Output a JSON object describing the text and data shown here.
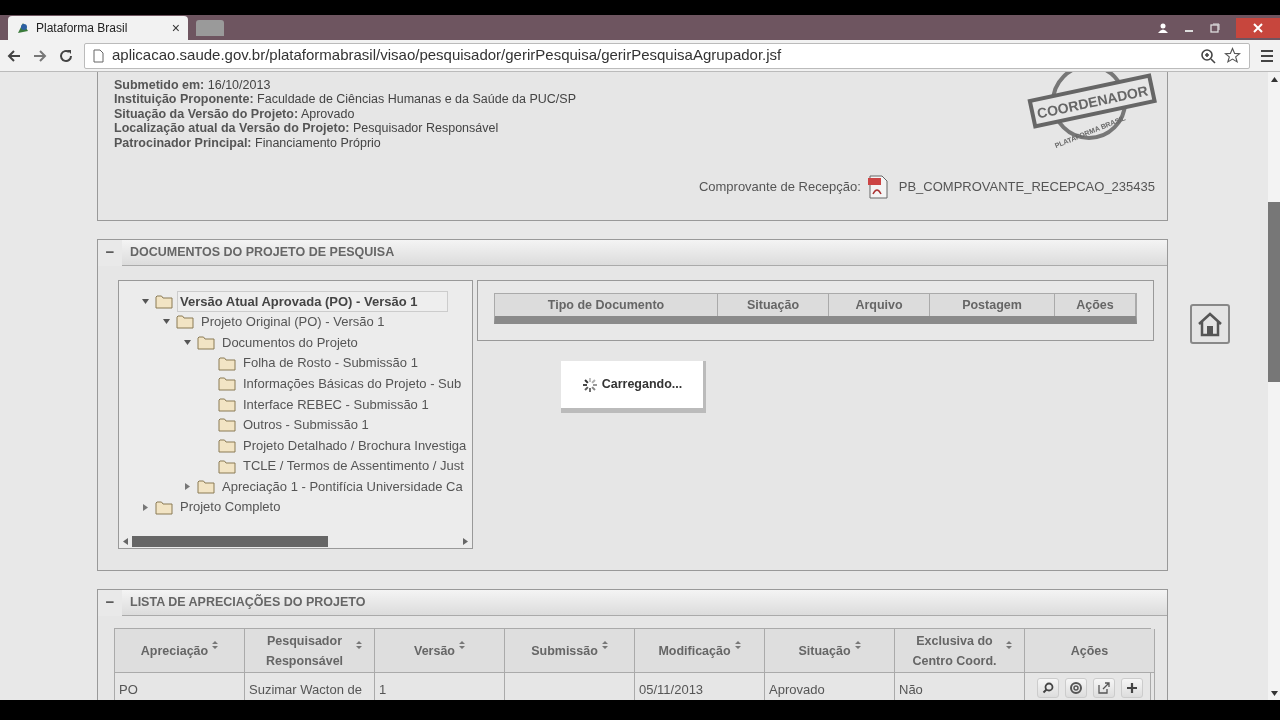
{
  "browser": {
    "tabs": [
      {
        "title": "Plataforma Brasil",
        "close": "×",
        "selected": true
      },
      {
        "selected": false
      }
    ],
    "url": "aplicacao.saude.gov.br/plataformabrasil/visao/pesquisador/gerirPesquisa/gerirPesquisaAgrupador.jsf"
  },
  "info": {
    "fields": [
      {
        "label": "Submetido em:",
        "value": "16/10/2013"
      },
      {
        "label": "Instituição Proponente:",
        "value": "Faculdade de Ciências Humanas e da Saúde da PUC/SP"
      },
      {
        "label": "Situação da Versão do Projeto:",
        "value": "Aprovado"
      },
      {
        "label": "Localização atual da Versão do Projeto:",
        "value": "Pesquisador Responsável"
      },
      {
        "label": "Patrocinador Principal:",
        "value": "Financiamento Próprio"
      }
    ],
    "stamp": {
      "label": "COORDENADOR",
      "ring_text": "PLATAFORMA BRASIL"
    },
    "receipt_label": "Comprovante de Recepção:",
    "receipt_file": "PB_COMPROVANTE_RECEPCAO_235435"
  },
  "documents": {
    "toggle": "−",
    "title": "DOCUMENTOS DO PROJETO DE PESQUISA",
    "tree": [
      {
        "label": "Versão Atual Aprovada (PO) - Versão 1",
        "selected": true,
        "expanded": true,
        "children": [
          {
            "label": "Projeto Original (PO) - Versão 1",
            "selected": false,
            "expanded": true,
            "children": [
              {
                "label": "Documentos do Projeto",
                "selected": false,
                "expanded": true,
                "children": [
                  {
                    "label": "Folha de Rosto - Submissão 1",
                    "selected": false
                  },
                  {
                    "label": "Informações Básicas do Projeto - Sub",
                    "selected": false
                  },
                  {
                    "label": "Interface REBEC - Submissão 1",
                    "selected": false
                  },
                  {
                    "label": "Outros - Submissão 1",
                    "selected": false
                  },
                  {
                    "label": "Projeto Detalhado / Brochura Investiga",
                    "selected": false
                  },
                  {
                    "label": "TCLE / Termos de Assentimento / Just",
                    "selected": false
                  }
                ]
              },
              {
                "label": "Apreciação 1 - Pontifícia Universidade Ca",
                "selected": false,
                "expanded": false
              }
            ]
          }
        ]
      },
      {
        "label": "Projeto Completo",
        "selected": false,
        "expanded": false
      }
    ],
    "columns": [
      "Tipo de Documento",
      "Situação",
      "Arquivo",
      "Postagem",
      "Ações"
    ],
    "loading": "Carregando..."
  },
  "appraisals": {
    "toggle": "−",
    "title": "LISTA DE APRECIAÇÕES DO PROJETO",
    "columns": [
      {
        "label": "Apreciação",
        "sortable": true
      },
      {
        "label": "Pesquisador Responsável",
        "sortable": true
      },
      {
        "label": "Versão",
        "sortable": true
      },
      {
        "label": "Submissão",
        "sortable": true
      },
      {
        "label": "Modificação",
        "sortable": true
      },
      {
        "label": "Situação",
        "sortable": true
      },
      {
        "label": "Exclusiva do Centro Coord.",
        "sortable": true
      },
      {
        "label": "Ações",
        "sortable": false
      }
    ],
    "rows": [
      {
        "cells": [
          "PO",
          "Suzimar Wacton de",
          "1",
          "",
          "05/11/2013",
          "Aprovado",
          "Não"
        ],
        "actions": [
          {
            "kind": "view"
          },
          {
            "kind": "history"
          },
          {
            "kind": "open"
          },
          {
            "kind": "add"
          }
        ]
      }
    ]
  }
}
